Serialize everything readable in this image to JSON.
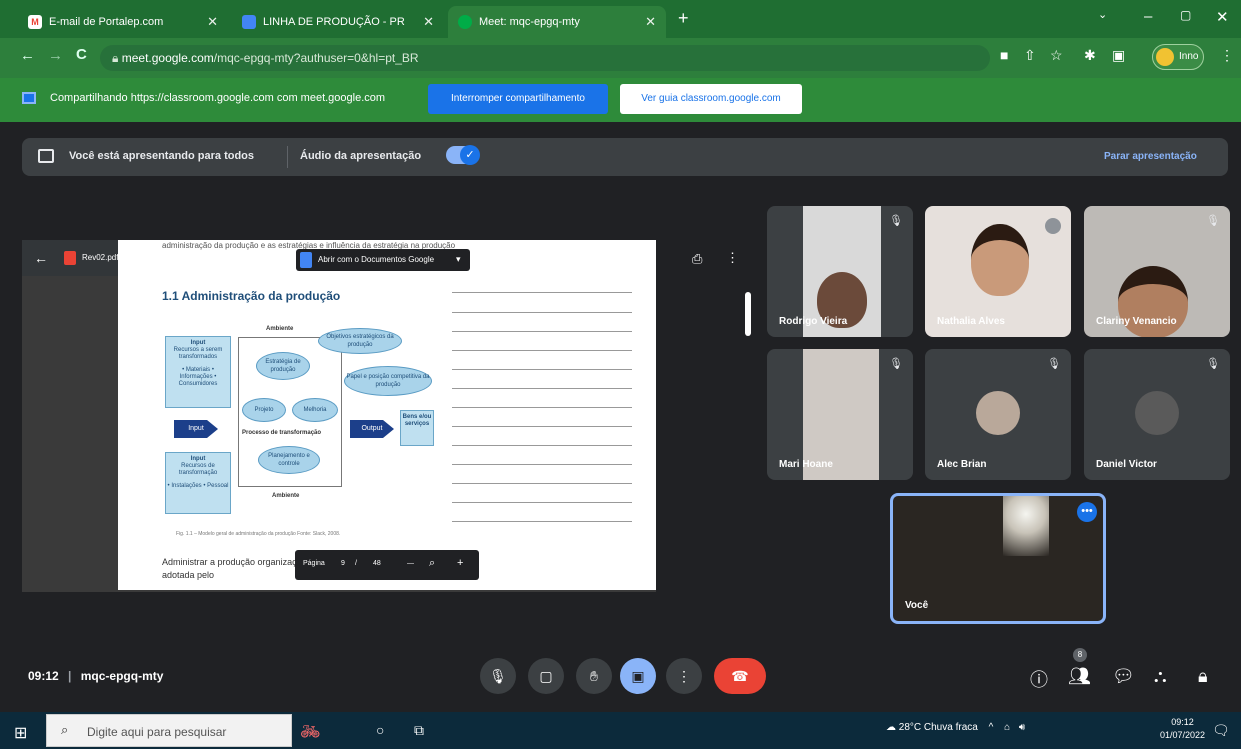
{
  "browser": {
    "tabs": [
      {
        "label": "E-mail de Portalep.com",
        "icon": "gmail-icon"
      },
      {
        "label": "LINHA DE PRODUÇÃO - PR",
        "icon": "docs-icon"
      },
      {
        "label": "Meet: mqc-epgq-mty",
        "icon": "meet-icon"
      }
    ],
    "url_domain": "meet.google.com",
    "url_path": "/mqc-epgq-mty?authuser=0&hl=pt_BR",
    "profile_label": "Inno"
  },
  "sharebar": {
    "message": "Compartilhando https://classroom.google.com com meet.google.com",
    "stop_button": "Interromper compartilhamento",
    "guide_button": "Ver guia classroom.google.com"
  },
  "presenting": {
    "message": "Você está apresentando para todos",
    "audio_label": "Áudio da apresentação",
    "stop_label": "Parar apresentação"
  },
  "pdf": {
    "file_name": "Rev02.pdf",
    "top_text": "administração da produção e as estratégias e influência da estratégia na produção",
    "open_with": "Abrir com o Documentos Google",
    "section_title": "1.1 Administração da produção",
    "labels": {
      "ambiente_top": "Ambiente",
      "ambiente_bottom": "Ambiente",
      "objetivos": "Objetivos estratégicos da produção",
      "estrategia": "Estratégia de produção",
      "papel": "Papel e posição competitiva da produção",
      "projeto": "Projeto",
      "melhoria": "Melhoria",
      "planejamento": "Planejamento e controle",
      "processo": "Processo de transformação",
      "input1_title": "Input",
      "input1_body": "Recursos a serem transformados",
      "input1_items": "• Materiais • Informações • Consumidores",
      "input2_title": "Input",
      "input2_body": "Recursos de transformação",
      "input2_items": "• Instalações • Pessoal",
      "input_arrow": "Input",
      "output_arrow": "Output",
      "bens": "Bens e/ou serviços"
    },
    "caption": "Fig. 1.1 – Modelo geral de administração da produção Fonte: Slack, 2008.",
    "body_text": "Administrar a produção organização adotada pelo",
    "page_label": "Página",
    "page_current": "9",
    "page_sep": "/",
    "page_total": "48",
    "zoom_out": "—",
    "zoom_in": "+"
  },
  "participants": [
    {
      "name": "Rodrigo Vieira",
      "muted": true
    },
    {
      "name": "Nathalia Alves",
      "muted": false
    },
    {
      "name": "Clariny Venancio",
      "muted": true
    },
    {
      "name": "Mari Hoane",
      "muted": true
    },
    {
      "name": "Alec Brian",
      "muted": true
    },
    {
      "name": "Daniel Victor",
      "muted": true
    }
  ],
  "self_tile": {
    "name": "Você"
  },
  "meeting": {
    "time": "09:12",
    "code": "mqc-epgq-mty",
    "participant_count": "8"
  },
  "taskbar": {
    "search_placeholder": "Digite aqui para pesquisar",
    "weather": "28°C Chuva fraca",
    "time": "09:12",
    "date": "01/07/2022"
  },
  "colors": {
    "browser_frame": "#1f6e32",
    "meet_background": "#202124",
    "accent_blue": "#1a73e8",
    "end_call_red": "#ea4335",
    "taskbar": "#0c2a3b"
  }
}
